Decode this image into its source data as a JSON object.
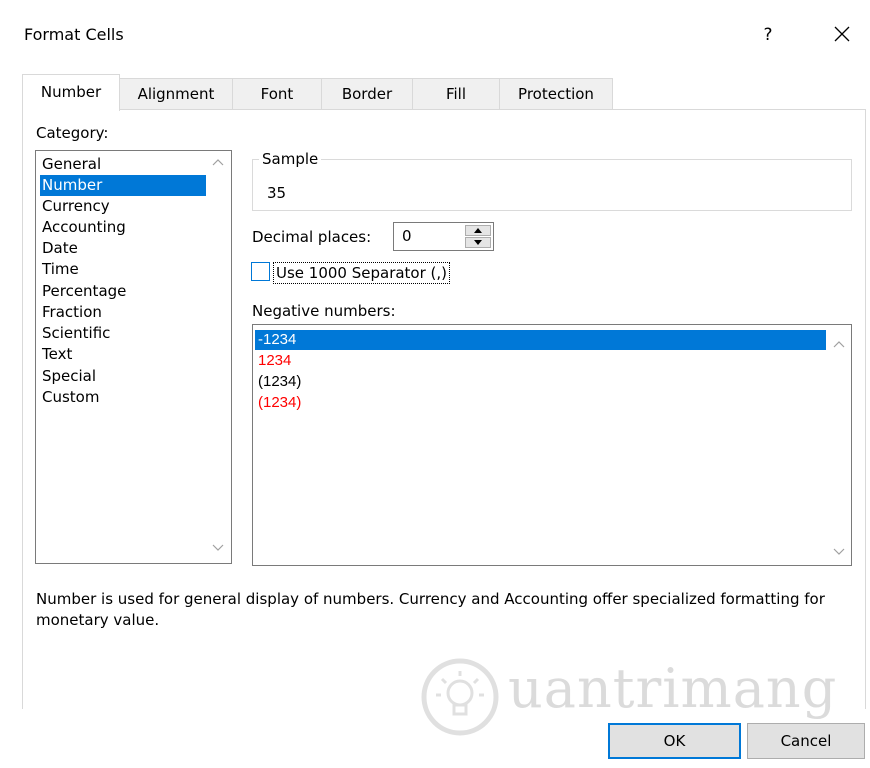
{
  "window": {
    "title": "Format Cells",
    "help_label": "?"
  },
  "tabs": [
    "Number",
    "Alignment",
    "Font",
    "Border",
    "Fill",
    "Protection"
  ],
  "category": {
    "label": "Category:",
    "items": [
      "General",
      "Number",
      "Currency",
      "Accounting",
      "Date",
      "Time",
      "Percentage",
      "Fraction",
      "Scientific",
      "Text",
      "Special",
      "Custom"
    ],
    "selected": "Number"
  },
  "sample": {
    "legend": "Sample",
    "value": "35"
  },
  "decimal": {
    "label": "Decimal places:",
    "value": "0"
  },
  "separator": {
    "label": "Use 1000 Separator (,)",
    "checked": false
  },
  "negative": {
    "label": "Negative numbers:",
    "items": [
      "-1234",
      "1234",
      "(1234)",
      "(1234)"
    ]
  },
  "description": "Number is used for general display of numbers.  Currency and Accounting offer specialized formatting for monetary value.",
  "watermark": "uantrimang",
  "buttons": {
    "ok": "OK",
    "cancel": "Cancel"
  },
  "colors": {
    "selection": "#0078d7",
    "negative_red": "#ff0000"
  }
}
